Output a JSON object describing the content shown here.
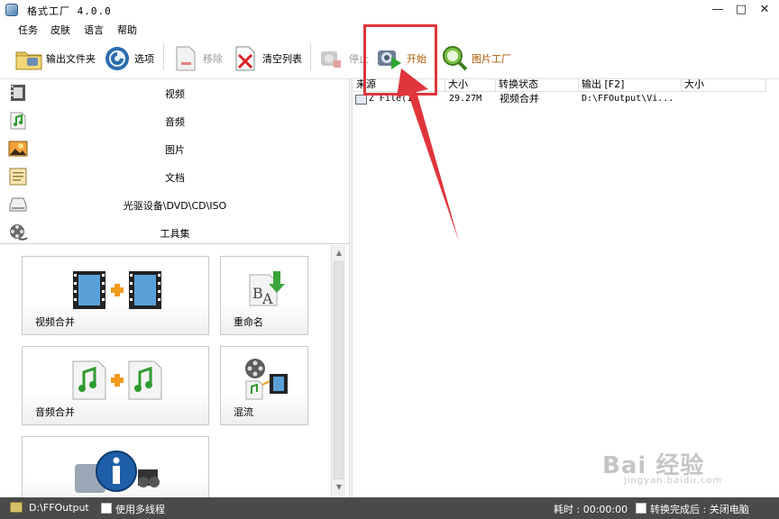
{
  "window": {
    "title": "格式工厂 4.0.0",
    "controls": [
      "—",
      "□",
      "✕"
    ]
  },
  "menu": [
    "任务",
    "皮肤",
    "语言",
    "帮助"
  ],
  "toolbar": {
    "output_folder": "输出文件夹",
    "options": "选项",
    "remove": "移除",
    "clear_list": "清空列表",
    "stop": "停止",
    "start": "开始",
    "picture_factory": "图片工厂"
  },
  "categories": [
    "视频",
    "音频",
    "图片",
    "文档",
    "光驱设备\\DVD\\CD\\ISO",
    "工具集"
  ],
  "tools": [
    "视频合并",
    "重命名",
    "音频合并",
    "混流"
  ],
  "filelist": {
    "columns": [
      "来源",
      "大小",
      "转换状态",
      "输出 [F2]",
      "大小"
    ],
    "rows": [
      {
        "source": "Z File(1",
        "size": "29.27M",
        "status": "视频合并",
        "output": "D:\\FFOutput\\Vi...",
        "out_size": ""
      }
    ]
  },
  "statusbar": {
    "output_path": "D:\\FFOutput",
    "multithread": "使用多线程",
    "elapsed": "耗时 : 00:00:00",
    "after_done": "转换完成后 : 关闭电脑"
  },
  "watermark": {
    "brand": "Bai 经验",
    "url": "jingyan.baidu.com"
  },
  "colors": {
    "highlight": "#e0353b",
    "statusbar": "#4a4a4a"
  }
}
